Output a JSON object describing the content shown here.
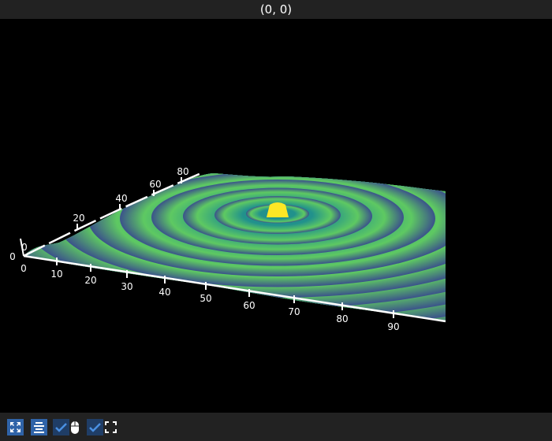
{
  "window": {
    "title": "(0, 0)"
  },
  "toolbar": {
    "items": [
      {
        "name": "reset-view-button",
        "icon": "expand-arrows-icon"
      },
      {
        "name": "align-button",
        "icon": "align-center-icon"
      },
      {
        "name": "mouse-interaction-checkbox",
        "icon": "mouse-icon",
        "checked": true
      },
      {
        "name": "fullscreen-checkbox",
        "icon": "fullscreen-icon",
        "checked": true
      }
    ]
  },
  "chart_data": {
    "type": "surface",
    "colormap": "viridis",
    "x_ticks": [
      "0",
      "10",
      "20",
      "30",
      "40",
      "50",
      "60",
      "70",
      "80",
      "90"
    ],
    "y_ticks": [
      "0",
      "20",
      "40",
      "60",
      "80"
    ],
    "z_ticks": [
      "0"
    ],
    "origin_label": "0",
    "colors": {
      "low": "#3b528b",
      "mid": "#21918c",
      "high": "#5ec962",
      "peak": "#fde725"
    }
  }
}
